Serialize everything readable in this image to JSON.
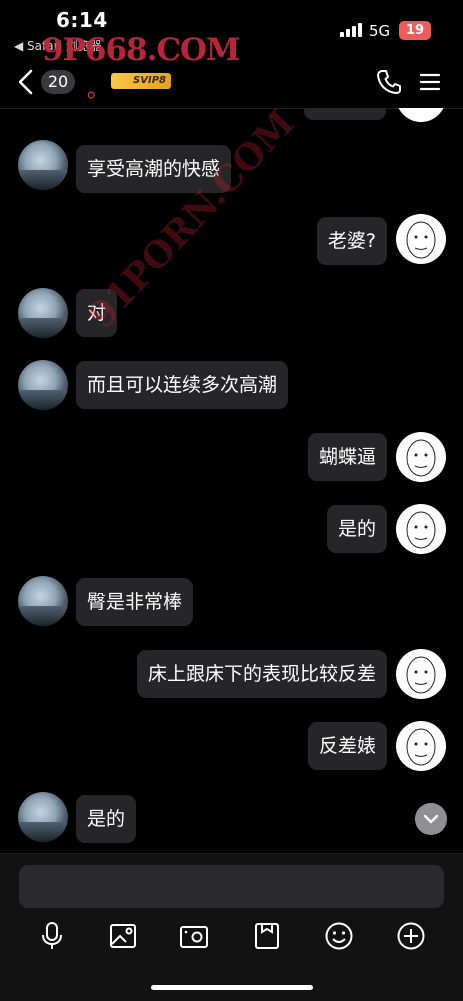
{
  "status_bar": {
    "time": "6:14",
    "back_app": "◀ Safari 浏览器",
    "network": "5G",
    "battery": "19",
    "battery_color": "#f05b5b"
  },
  "watermark": {
    "top_text": "9P668.COM",
    "diagonal_text": "91PORN.COM"
  },
  "nav": {
    "unread_count": "20",
    "contact_suffix": "。",
    "vip_badge": "SVIP8",
    "back_icon": "chevron-left-icon",
    "call_icon": "phone-icon",
    "menu_icon": "menu-icon"
  },
  "messages": [
    {
      "side": "left",
      "text": "享受高潮的快感"
    },
    {
      "side": "right",
      "text": "老婆?"
    },
    {
      "side": "left",
      "text": "对"
    },
    {
      "side": "left",
      "text": "而且可以连续多次高潮"
    },
    {
      "side": "right",
      "text": "蝴蝶逼"
    },
    {
      "side": "right",
      "text": "是的"
    },
    {
      "side": "left",
      "text": "臀是非常棒"
    },
    {
      "side": "right",
      "text": "床上跟床下的表现比较反差"
    },
    {
      "side": "right",
      "text": "反差婊"
    },
    {
      "side": "left",
      "text": "是的"
    }
  ],
  "composer": {
    "input_value": "",
    "tools": [
      "microphone-icon",
      "image-icon",
      "camera-icon",
      "package-icon",
      "emoji-icon",
      "plus-icon"
    ]
  },
  "colors": {
    "background": "#000000",
    "bubble": "#262628",
    "watermark": "#c2283b"
  }
}
